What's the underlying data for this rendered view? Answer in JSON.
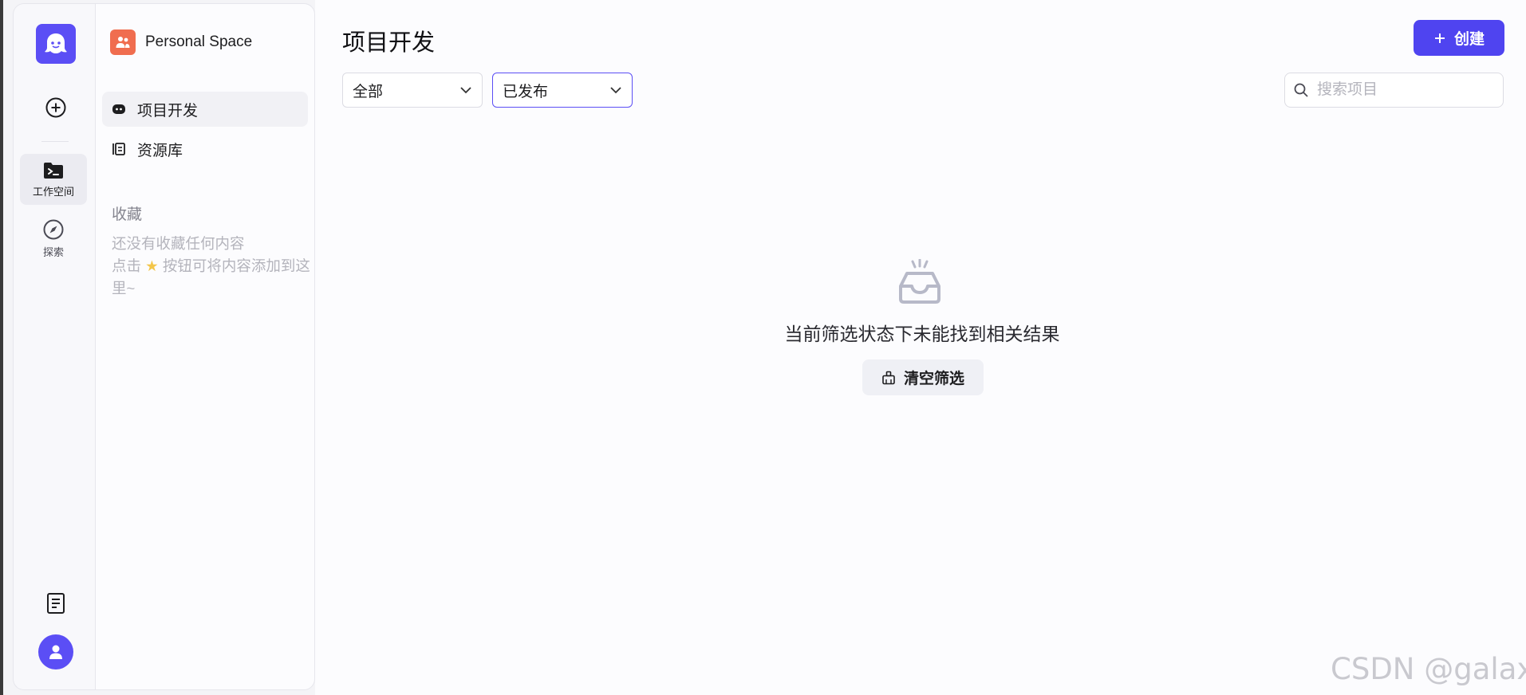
{
  "rail": {
    "nav": [
      {
        "label": "工作空间",
        "icon": "terminal-folder-icon",
        "active": true
      },
      {
        "label": "探索",
        "icon": "compass-icon",
        "active": false
      }
    ],
    "icons": {
      "logo": "ghost-logo-icon",
      "add": "plus-circle-icon",
      "docs": "document-icon",
      "avatar": "user-icon"
    }
  },
  "sidebar": {
    "space_name": "Personal Space",
    "items": [
      {
        "label": "项目开发",
        "icon": "robot-icon",
        "active": true
      },
      {
        "label": "资源库",
        "icon": "library-icon",
        "active": false
      }
    ],
    "favorites_title": "收藏",
    "favorites_empty_line1": "还没有收藏任何内容",
    "favorites_empty_prefix": "点击",
    "favorites_empty_suffix": "按钮可将内容添加到这里~"
  },
  "main": {
    "title": "项目开发",
    "create_label": "创建",
    "filter_type": "全部",
    "filter_status": "已发布",
    "search_placeholder": "搜索项目",
    "empty_message": "当前筛选状态下未能找到相关结果",
    "clear_label": "清空筛选"
  },
  "watermark": "CSDN @galaxy",
  "colors": {
    "accent": "#4f44f0",
    "space_icon": "#f06d4f",
    "muted": "#b4b4bc"
  }
}
